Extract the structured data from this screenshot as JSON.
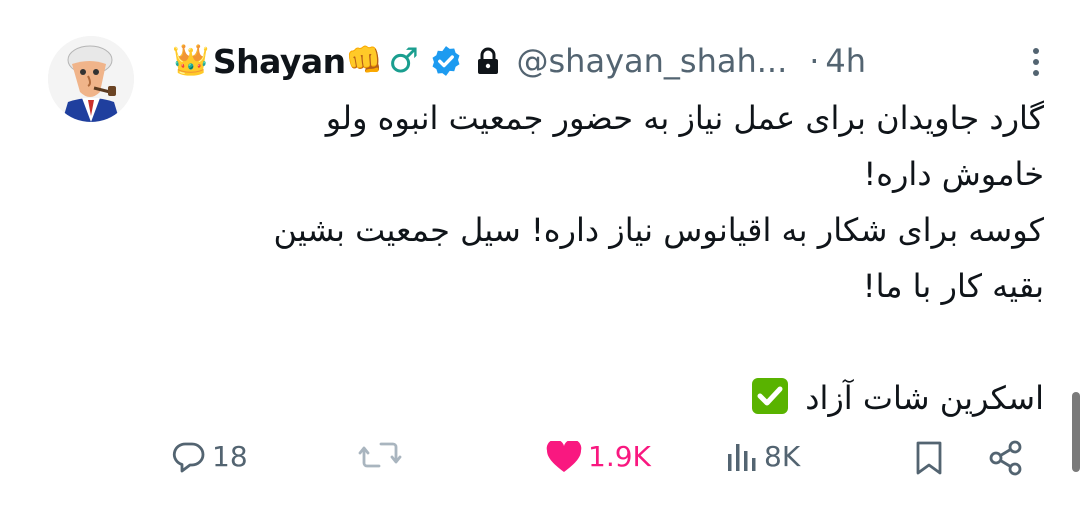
{
  "tweet": {
    "author": {
      "name": "Shayan",
      "crown_emoji": "👑",
      "fist_emoji": "👊",
      "gender_symbol": "♂",
      "handle": "@shayan_shah...",
      "verified_icon": "verified-badge-icon",
      "protected_icon": "lock-icon"
    },
    "separator": "·",
    "time": "4h",
    "text_lines": [
      "گارد جاویدان برای عمل نیاز به حضور جمعیت انبوه ولو",
      "خاموش داره!",
      "کوسه برای شکار به اقیانوس نیاز داره! سیل جمعیت بشین",
      "بقیه کار با ما!",
      "",
      "اسکرین شات آزاد"
    ],
    "check_emoji": "✅",
    "actions": {
      "replies": "18",
      "reposts": "",
      "likes": "1.9K",
      "views": "8K"
    },
    "colors": {
      "like": "#f91880",
      "verified": "#1d9bf0",
      "secondary_text": "#536471",
      "text": "#0f1419"
    }
  }
}
